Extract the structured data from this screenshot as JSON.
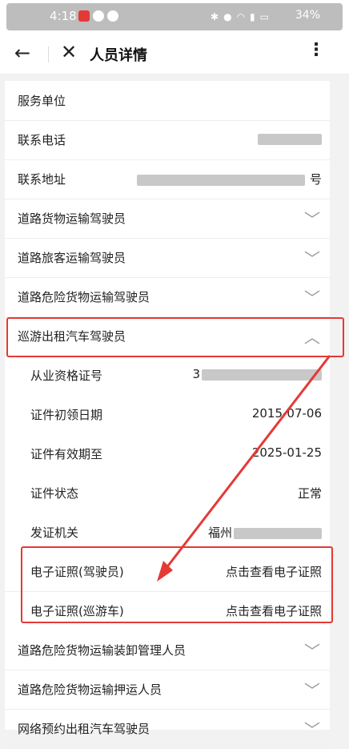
{
  "status": {
    "time": "4:18",
    "battery": "34%"
  },
  "nav": {
    "title": "人员详情"
  },
  "rows": [
    {
      "label": "服务单位",
      "value": ""
    },
    {
      "label": "联系电话",
      "value": ""
    },
    {
      "label": "联系地址",
      "value": "号"
    },
    {
      "label": "道路货物运输驾驶员"
    },
    {
      "label": "道路旅客运输驾驶员"
    },
    {
      "label": "道路危险货物运输驾驶员"
    },
    {
      "label": "巡游出租汽车驾驶员"
    }
  ],
  "subrows": [
    {
      "label": "从业资格证号",
      "value": "3"
    },
    {
      "label": "证件初领日期",
      "value": "2015-07-06"
    },
    {
      "label": "证件有效期至",
      "value": "2025-01-25"
    },
    {
      "label": "证件状态",
      "value": "正常"
    },
    {
      "label": "发证机关",
      "value": "福州"
    },
    {
      "label": "电子证照(驾驶员)",
      "value": "点击查看电子证照"
    },
    {
      "label": "电子证照(巡游车)",
      "value": "点击查看电子证照"
    }
  ],
  "bottom_rows": [
    {
      "label": "道路危险货物运输装卸管理人员"
    },
    {
      "label": "道路危险货物运输押运人员"
    },
    {
      "label": "网络预约出租汽车驾驶员"
    }
  ],
  "colors": {
    "highlight": "#e53935"
  }
}
